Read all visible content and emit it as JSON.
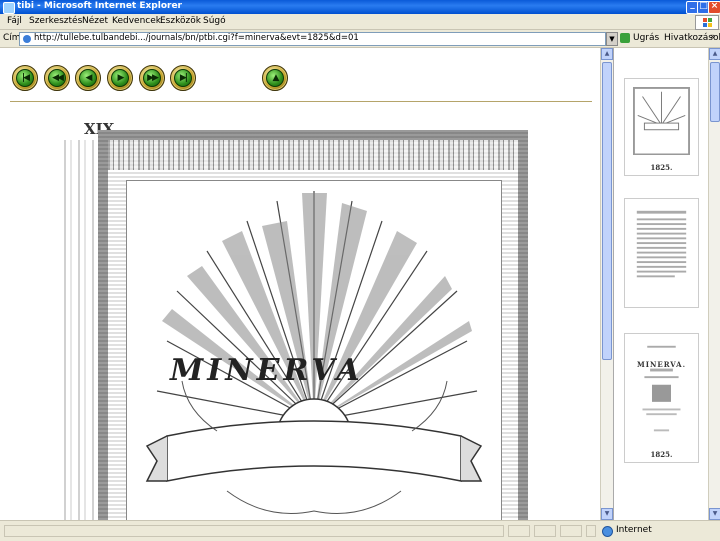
{
  "window": {
    "title": "tibi - Microsoft Internet Explorer"
  },
  "menu": {
    "items": [
      "Fájl",
      "Szerkesztés",
      "Nézet",
      "Kedvencek",
      "Eszközök",
      "Súgó"
    ]
  },
  "address": {
    "label": "Cím",
    "url": "http://tullebe.tulbandebi.../journals/bn/ptbi.cgi?f=minerva&evt=1825&d=01",
    "go_label": "Ugrás",
    "links_label": "Hivatkozások",
    "links_arrow": "»"
  },
  "navigation": {
    "buttons": [
      {
        "name": "first-page-button",
        "glyph": "|◀"
      },
      {
        "name": "previous-section-button",
        "glyph": "◀◀"
      },
      {
        "name": "previous-page-button",
        "glyph": "◀"
      },
      {
        "name": "next-page-button",
        "glyph": "▶"
      },
      {
        "name": "next-section-button",
        "glyph": "▶▶"
      },
      {
        "name": "last-page-button",
        "glyph": "▶|"
      },
      {
        "name": "up-button",
        "glyph": "▲"
      }
    ]
  },
  "document": {
    "page_number": "XIX",
    "banner": "MINERVA"
  },
  "thumbnails": [
    {
      "caption": "1825."
    },
    {
      "caption": ""
    },
    {
      "title": "MINERVA.",
      "caption": "1825."
    }
  ],
  "status": {
    "zone": "Internet"
  },
  "colors": {
    "titlebar": "#0a5ad8",
    "chrome": "#ece9d8",
    "nav_button_ring": "#c9a830",
    "nav_button_core": "#2f8f1c"
  }
}
